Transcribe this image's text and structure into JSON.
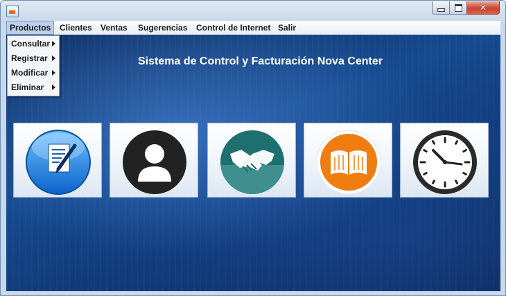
{
  "window": {
    "controls": {
      "minimize_icon": "minimize-icon",
      "maximize_icon": "maximize-icon",
      "close_icon": "close-icon"
    }
  },
  "menubar": {
    "items": [
      {
        "label": "Productos"
      },
      {
        "label": "Clientes"
      },
      {
        "label": "Ventas"
      },
      {
        "label": "Sugerencias"
      },
      {
        "label": "Control de Internet"
      },
      {
        "label": "Salir"
      }
    ]
  },
  "dropdown": {
    "items": [
      {
        "label": "Consultar"
      },
      {
        "label": "Registrar"
      },
      {
        "label": "Modificar"
      },
      {
        "label": "Eliminar"
      }
    ]
  },
  "main": {
    "title": "Sistema de Control y Facturación Nova Center",
    "tiles": [
      {
        "icon": "document-pen-icon"
      },
      {
        "icon": "user-icon"
      },
      {
        "icon": "handshake-icon"
      },
      {
        "icon": "open-book-icon"
      },
      {
        "icon": "clock-icon"
      }
    ]
  },
  "colors": {
    "tile_blue": "#1e88e5",
    "tile_dark": "#222222",
    "tile_teal": "#2e8b8b",
    "tile_orange": "#f07d10"
  }
}
